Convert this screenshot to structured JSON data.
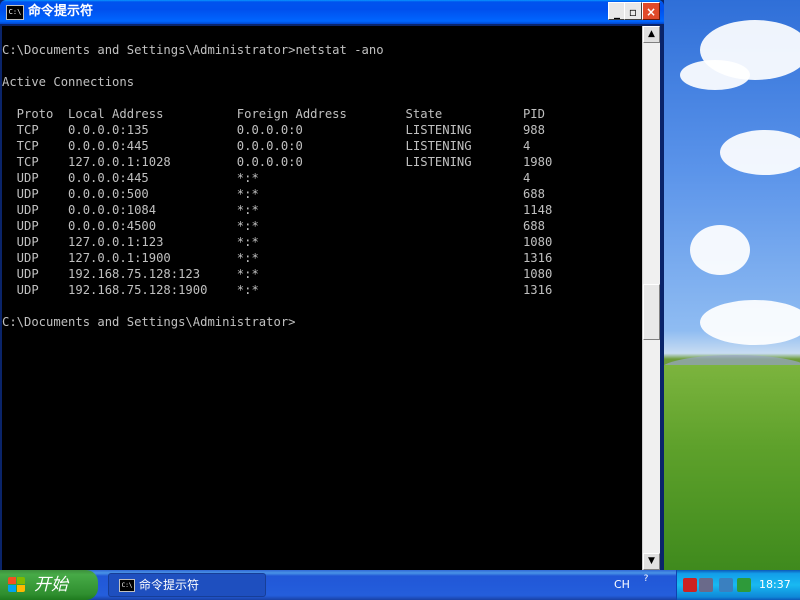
{
  "window": {
    "title": "命令提示符",
    "icon_text": "C:\\",
    "buttons": {
      "minimize": "_",
      "maximize": "▫",
      "close": "×"
    }
  },
  "console": {
    "lines": [
      "",
      "C:\\Documents and Settings\\Administrator>netstat -ano",
      "",
      "Active Connections",
      "",
      "  Proto  Local Address          Foreign Address        State           PID",
      "  TCP    0.0.0.0:135            0.0.0.0:0              LISTENING       988",
      "  TCP    0.0.0.0:445            0.0.0.0:0              LISTENING       4",
      "  TCP    127.0.0.1:1028         0.0.0.0:0              LISTENING       1980",
      "  UDP    0.0.0.0:445            *:*                                    4",
      "  UDP    0.0.0.0:500            *:*                                    688",
      "  UDP    0.0.0.0:1084           *:*                                    1148",
      "  UDP    0.0.0.0:4500           *:*                                    688",
      "  UDP    127.0.0.1:123          *:*                                    1080",
      "  UDP    127.0.0.1:1900         *:*                                    1316",
      "  UDP    192.168.75.128:123     *:*                                    1080",
      "  UDP    192.168.75.128:1900    *:*                                    1316",
      "",
      "C:\\Documents and Settings\\Administrator>"
    ]
  },
  "scrollbar": {
    "up_arrow": "▲",
    "down_arrow": "▼"
  },
  "taskbar": {
    "start_label": "开始",
    "task_button_label": "命令提示符",
    "task_icon_text": "C:\\",
    "language": "CH",
    "language_help": "?",
    "tray_icons": [
      "shield-icon",
      "vm-icon",
      "network-icon",
      "update-icon"
    ],
    "tray_icon_colors": [
      "#cc2222",
      "#6a6a8a",
      "#3a80c0",
      "#2e9a3a"
    ],
    "clock": "18:37"
  }
}
